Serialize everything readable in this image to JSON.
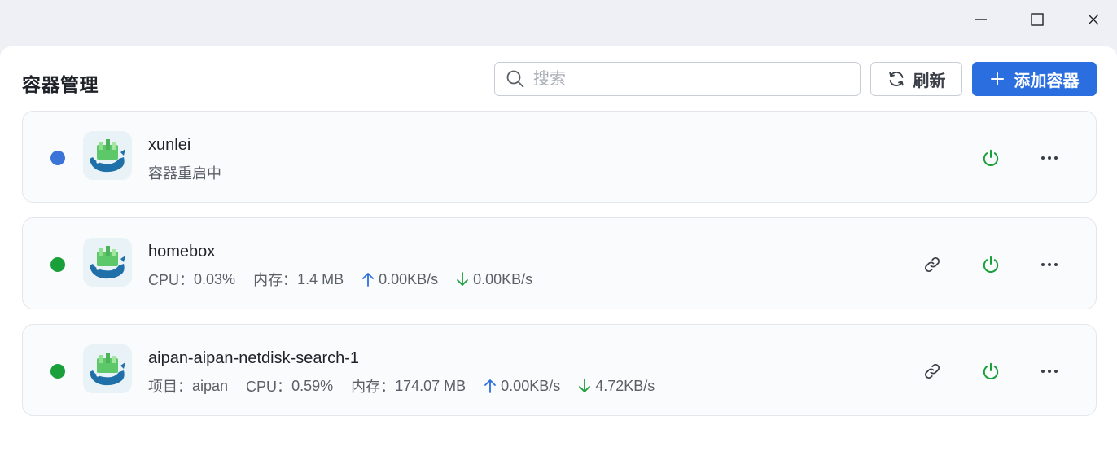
{
  "window": {
    "minimize_icon": "minimize-icon",
    "maximize_icon": "maximize-icon",
    "close_icon": "close-icon"
  },
  "header": {
    "title": "容器管理",
    "search_placeholder": "搜索",
    "refresh_label": "刷新",
    "add_label": "添加容器"
  },
  "colors": {
    "accent": "#2a6ee0",
    "status_restarting": "#3a74d9",
    "status_running": "#1aa03a",
    "power": "#1aa03a",
    "upload": "#2a6ee0",
    "download": "#1aa03a"
  },
  "containers": [
    {
      "name": "xunlei",
      "status": "restarting",
      "status_text": "容器重启中"
    },
    {
      "name": "homebox",
      "status": "running",
      "cpu_label": "CPU：",
      "cpu": "0.03%",
      "mem_label": "内存：",
      "mem": "1.4 MB",
      "up": "0.00KB/s",
      "down": "0.00KB/s"
    },
    {
      "name": "aipan-aipan-netdisk-search-1",
      "status": "running",
      "project_label": "项目：",
      "project": "aipan",
      "cpu_label": "CPU：",
      "cpu": "0.59%",
      "mem_label": "内存：",
      "mem": "174.07 MB",
      "up": "0.00KB/s",
      "down": "4.72KB/s"
    }
  ]
}
